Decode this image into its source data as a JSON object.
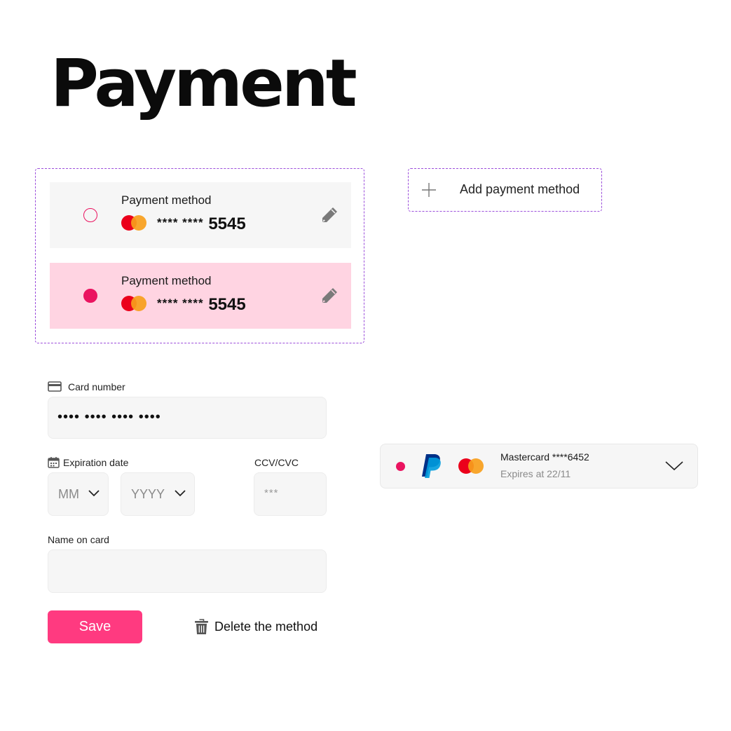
{
  "page": {
    "title": "Payment"
  },
  "saved_methods": [
    {
      "label": "Payment method",
      "mask": "**** ****",
      "last4": "5545",
      "selected": false
    },
    {
      "label": "Payment method",
      "mask": "**** ****",
      "last4": "5545",
      "selected": true
    }
  ],
  "add_method": {
    "label": "Add payment method"
  },
  "form": {
    "card_number": {
      "label": "Card number",
      "value": "•••• •••• •••• ••••"
    },
    "expiration": {
      "label": "Expiration date",
      "month_placeholder": "MM",
      "year_placeholder": "YYYY"
    },
    "cvc": {
      "label": "CCV/CVC",
      "placeholder": "***"
    },
    "name": {
      "label": "Name on card",
      "value": ""
    },
    "save_label": "Save",
    "delete_label": "Delete the method"
  },
  "payment_select": {
    "title": "Mastercard ****6452",
    "subtitle": "Expires at 22/11"
  },
  "colors": {
    "accent": "#ea1460",
    "button": "#ff3a80",
    "selected_bg": "#ffd4e2",
    "dashed_border": "#9b4ddb",
    "mastercard_red": "#eb001b",
    "mastercard_orange": "#f79e1b",
    "paypal_dark": "#003087",
    "paypal_light": "#009cde"
  },
  "icons": [
    "radio-icon",
    "mastercard-icon",
    "pencil-icon",
    "plus-icon",
    "credit-card-icon",
    "calendar-icon",
    "chevron-down-icon",
    "trash-icon",
    "paypal-icon"
  ]
}
